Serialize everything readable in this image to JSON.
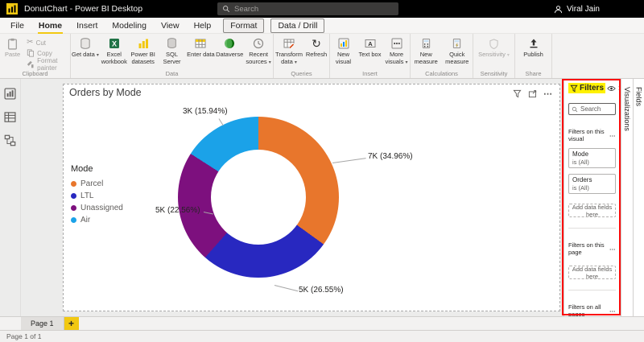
{
  "titlebar": {
    "title": "DonutChart - Power BI Desktop",
    "search_placeholder": "Search",
    "user": "Viral Jain"
  },
  "menubar": {
    "file": "File",
    "home": "Home",
    "insert": "Insert",
    "modeling": "Modeling",
    "view": "View",
    "help": "Help",
    "format": "Format",
    "data_drill": "Data / Drill"
  },
  "ribbon": {
    "paste": "Paste",
    "cut": "Cut",
    "copy": "Copy",
    "format_painter": "Format painter",
    "get_data": "Get data",
    "excel_workbook": "Excel workbook",
    "pbi_datasets": "Power BI datasets",
    "sql_server": "SQL Server",
    "enter_data": "Enter data",
    "dataverse": "Dataverse",
    "recent_sources": "Recent sources",
    "transform_data": "Transform data",
    "refresh": "Refresh",
    "new_visual": "New visual",
    "text_box": "Text box",
    "more_visuals": "More visuals",
    "new_measure": "New measure",
    "quick_measure": "Quick measure",
    "sensitivity": "Sensitivity",
    "publish": "Publish",
    "groups": {
      "clipboard": "Clipboard",
      "data": "Data",
      "queries": "Queries",
      "insert": "Insert",
      "calculations": "Calculations",
      "sensitivity": "Sensitivity",
      "share": "Share"
    }
  },
  "glyphs": {
    "ellipsis": "⋯",
    "chevron_right": "›",
    "caret_down": "▾",
    "scissors": "✂",
    "refresh": "↻",
    "plus": "+"
  },
  "chart_data": {
    "type": "pie",
    "donut": true,
    "inner_radius_ratio": 0.59,
    "title": "Orders by Mode",
    "legend_title": "Mode",
    "legend_position": "left",
    "categories": [
      "Parcel",
      "LTL",
      "Unassigned",
      "Air"
    ],
    "values": [
      7000,
      5000,
      5000,
      3000
    ],
    "percentages": [
      34.96,
      26.55,
      22.56,
      15.94
    ],
    "labels": [
      "7K (34.96%)",
      "5K (26.55%)",
      "5K (22.56%)",
      "3K (15.94%)"
    ],
    "colors": [
      "#E8762C",
      "#2828C0",
      "#7D107E",
      "#1BA2E8"
    ]
  },
  "filters_panel": {
    "title": "Filters",
    "search_placeholder": "Search",
    "section_visual": "Filters on this visual",
    "section_page": "Filters on this page",
    "section_all": "Filters on all pages",
    "card_mode_name": "Mode",
    "card_mode_value": "is (All)",
    "card_orders_name": "Orders",
    "card_orders_value": "is (All)",
    "add_placeholder": "Add data fields here"
  },
  "right_tabs": {
    "visualizations": "Visualizations",
    "fields": "Fields"
  },
  "pagebar": {
    "page_tab": "Page 1"
  },
  "statusbar": {
    "text": "Page 1 of 1"
  },
  "colors": {
    "accent": "#F2C811",
    "annotation_red": "#FB0A0A",
    "annotation_highlight": "#FFF100",
    "titlebar_bg": "#000000"
  }
}
